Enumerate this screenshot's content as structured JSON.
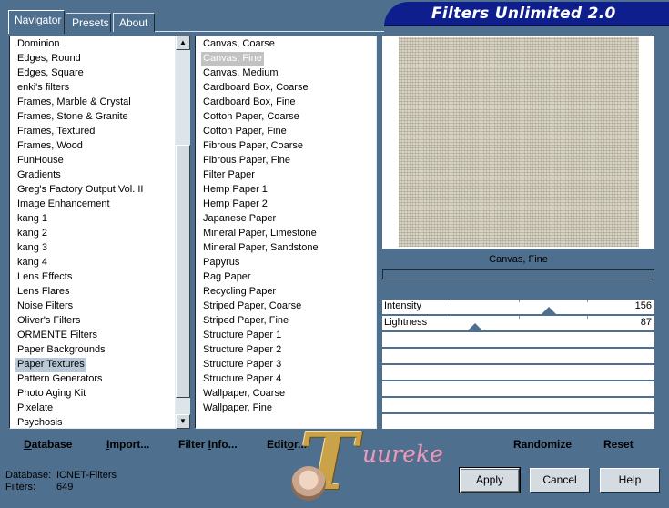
{
  "tabs": [
    {
      "label": "Navigator",
      "active": true
    },
    {
      "label": "Presets",
      "active": false
    },
    {
      "label": "About",
      "active": false
    }
  ],
  "banner": {
    "title": "Filters Unlimited 2.0"
  },
  "categories": [
    "Dominion",
    "Edges, Round",
    "Edges, Square",
    "enki's filters",
    "Frames, Marble & Crystal",
    "Frames, Stone & Granite",
    "Frames, Textured",
    "Frames, Wood",
    "FunHouse",
    "Gradients",
    "Greg's Factory Output Vol. II",
    "Image Enhancement",
    "kang 1",
    "kang 2",
    "kang 3",
    "kang 4",
    "Lens Effects",
    "Lens Flares",
    "Noise Filters",
    "Oliver's Filters",
    "ORMENTE Filters",
    "Paper Backgrounds",
    "Paper Textures",
    "Pattern Generators",
    "Photo Aging Kit",
    "Pixelate",
    "Psychosis"
  ],
  "selected_category": "Paper Textures",
  "filters": [
    "Canvas, Coarse",
    "Canvas, Fine",
    "Canvas, Medium",
    "Cardboard Box, Coarse",
    "Cardboard Box, Fine",
    "Cotton Paper, Coarse",
    "Cotton Paper, Fine",
    "Fibrous Paper, Coarse",
    "Fibrous Paper, Fine",
    "Filter Paper",
    "Hemp Paper 1",
    "Hemp Paper 2",
    "Japanese Paper",
    "Mineral Paper, Limestone",
    "Mineral Paper, Sandstone",
    "Papyrus",
    "Rag Paper",
    "Recycling Paper",
    "Striped Paper, Coarse",
    "Striped Paper, Fine",
    "Structure Paper 1",
    "Structure Paper 2",
    "Structure Paper 3",
    "Structure Paper 4",
    "Wallpaper, Coarse",
    "Wallpaper, Fine"
  ],
  "selected_filter": "Canvas, Fine",
  "preview": {
    "caption": "Canvas, Fine"
  },
  "sliders": [
    {
      "label": "Intensity",
      "value": "156",
      "level": 156
    },
    {
      "label": "Lightness",
      "value": "87",
      "level": 87
    }
  ],
  "actions": {
    "database_a": "D",
    "database_b": "atabase",
    "import_a": "I",
    "import_b": "mport...",
    "filter_info_a": "Filter ",
    "filter_info_b": "I",
    "filter_info_c": "nfo...",
    "editor_a": "Edit",
    "editor_b": "o",
    "editor_c": "r...",
    "randomize": "Randomize",
    "reset": "Reset"
  },
  "status": {
    "database_label": "Database:",
    "database_value": "ICNET-Filters",
    "filters_label": "Filters:",
    "filters_value": "649"
  },
  "buttons": {
    "apply": "Apply",
    "cancel": "Cancel",
    "help": "Help"
  },
  "watermark": {
    "letter": "T",
    "text": "uureke"
  }
}
